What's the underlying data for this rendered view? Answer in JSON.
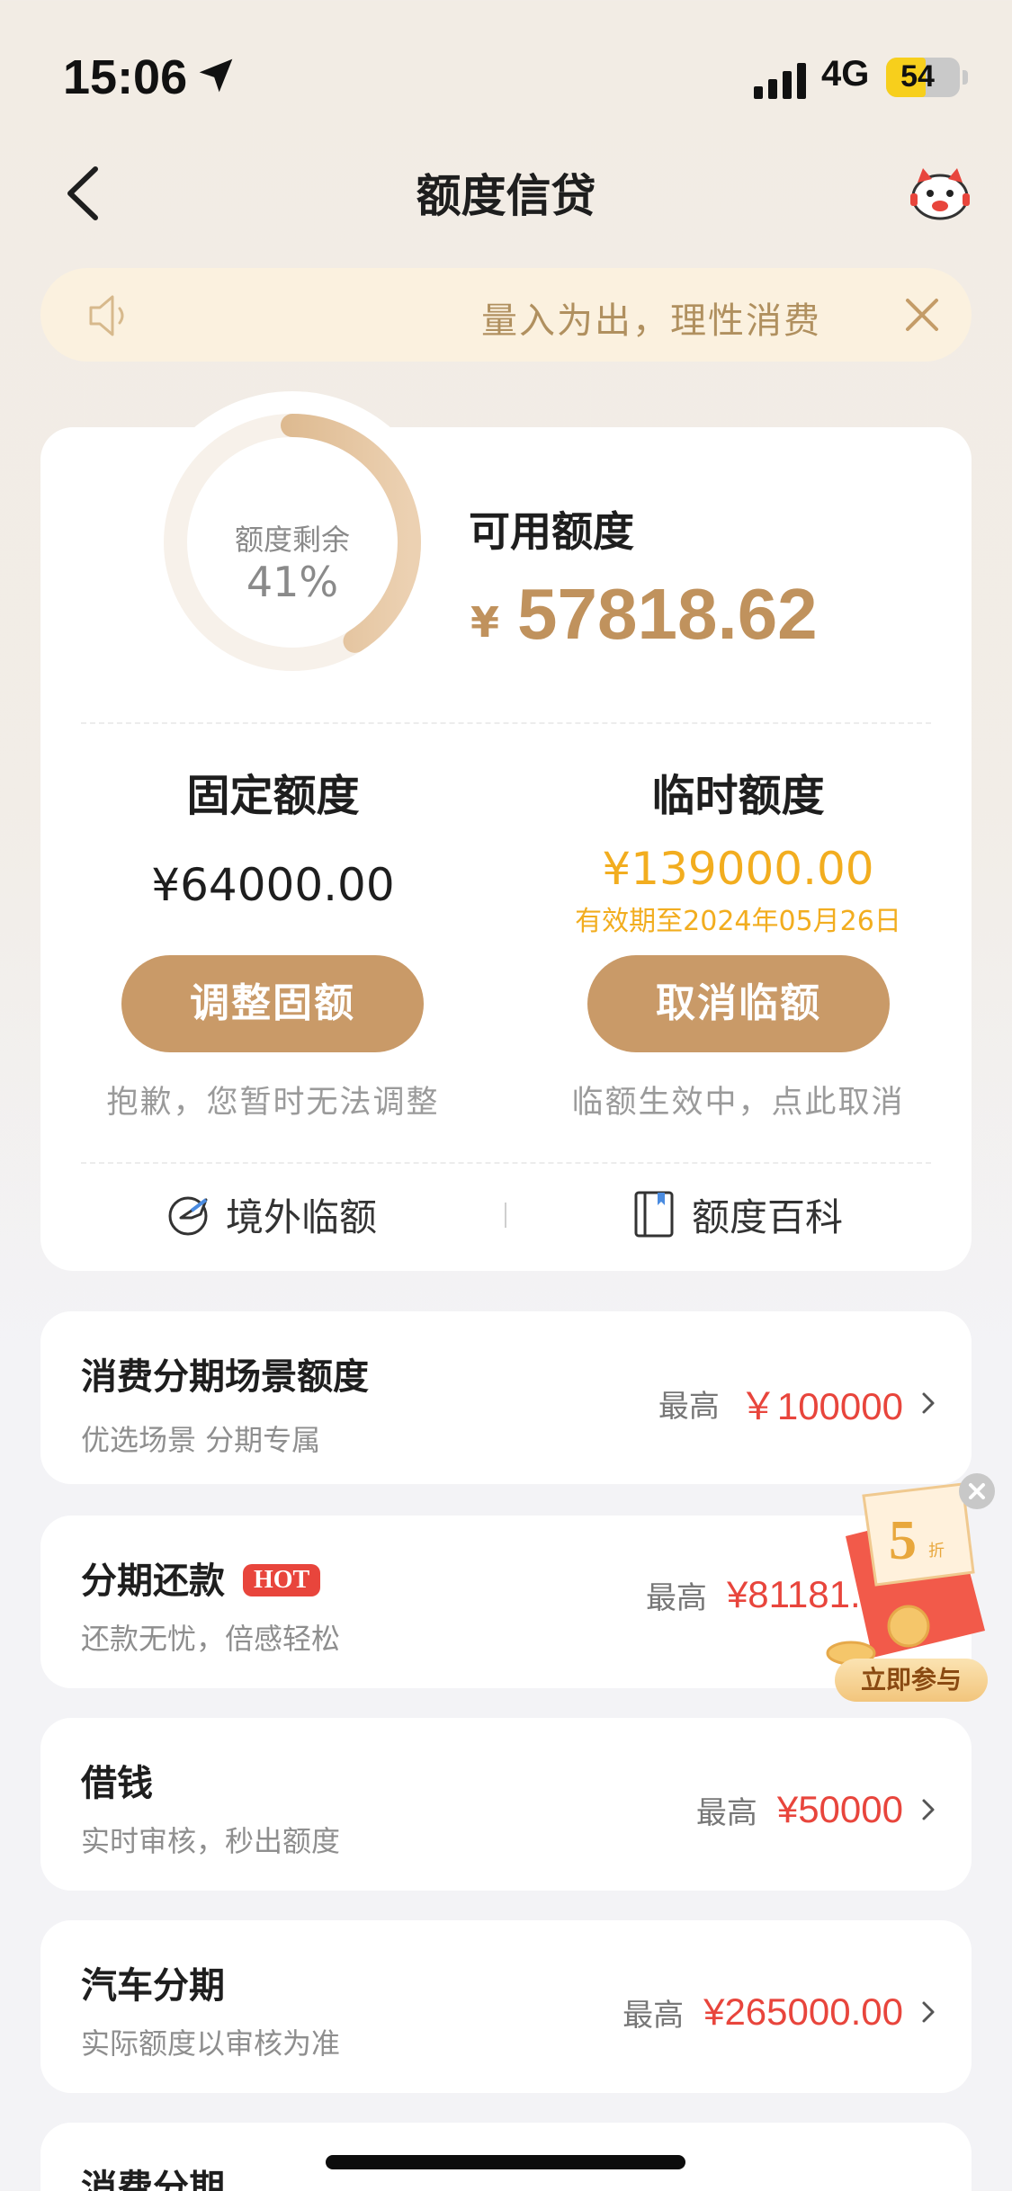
{
  "status_bar": {
    "time": "15:06",
    "network": "4G",
    "battery": "54",
    "battery_level": 0.54
  },
  "header": {
    "title": "额度信贷"
  },
  "notice": {
    "text": "量入为出，理性消费"
  },
  "credit": {
    "ring_label": "额度剩余",
    "ring_percent": "41%",
    "ring_fraction": 0.41,
    "available_label": "可用额度",
    "available_currency": "¥",
    "available_amount": "57818.62",
    "fixed": {
      "title": "固定额度",
      "amount": "¥64000.00",
      "button": "调整固额",
      "hint": "抱歉，您暂时无法调整"
    },
    "temp": {
      "title": "临时额度",
      "amount": "¥139000.00",
      "valid": "有效期至2024年05月26日",
      "button": "取消临额",
      "hint": "临额生效中，点此取消"
    },
    "links": [
      {
        "label": "境外临额",
        "icon": "overseas-plane-icon"
      },
      {
        "label": "额度百科",
        "icon": "book-icon"
      }
    ]
  },
  "items": [
    {
      "title": "消费分期场景额度",
      "sub": "优选场景 分期专属",
      "max_label": "最高",
      "max_value": "￥100000"
    },
    {
      "title": "分期还款",
      "badge": "HOT",
      "sub": "还款无忧，倍感轻松",
      "max_label": "最高",
      "max_value": "¥81181.0"
    },
    {
      "title": "借钱",
      "sub": "实时审核，秒出额度",
      "max_label": "最高",
      "max_value": "¥50000"
    },
    {
      "title": "汽车分期",
      "sub": "实际额度以审核为准",
      "max_label": "最高",
      "max_value": "¥265000.00"
    },
    {
      "title": "消费分期"
    }
  ],
  "promo": {
    "badge": "5",
    "badge_suffix": "折",
    "button": "立即参与"
  },
  "colors": {
    "gold": "#c0925d",
    "button": "#c99a68",
    "amber": "#f2ad1f",
    "red": "#e8453c"
  }
}
